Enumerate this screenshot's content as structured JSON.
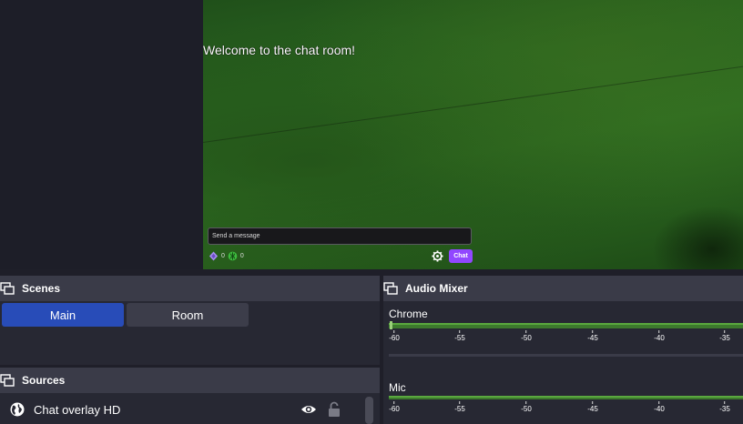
{
  "preview": {
    "welcome_text": "Welcome to the chat room!",
    "message_placeholder": "Send a message",
    "points_a": "0",
    "points_b": "0",
    "chat_button": "Chat"
  },
  "scenes": {
    "title": "Scenes",
    "items": [
      {
        "label": "Main",
        "active": true
      },
      {
        "label": "Room",
        "active": false
      }
    ]
  },
  "sources": {
    "title": "Sources",
    "items": [
      {
        "label": "Chat overlay HD"
      }
    ]
  },
  "audio_mixer": {
    "title": "Audio Mixer",
    "ticks": [
      "-60",
      "-55",
      "-50",
      "-45",
      "-40",
      "-35"
    ],
    "channels": [
      {
        "name": "Chrome"
      },
      {
        "name": "Mic"
      }
    ]
  },
  "colors": {
    "accent_blue": "#284cb8",
    "chat_purple": "#9147ff",
    "meter_green": "#3d7a2d"
  }
}
